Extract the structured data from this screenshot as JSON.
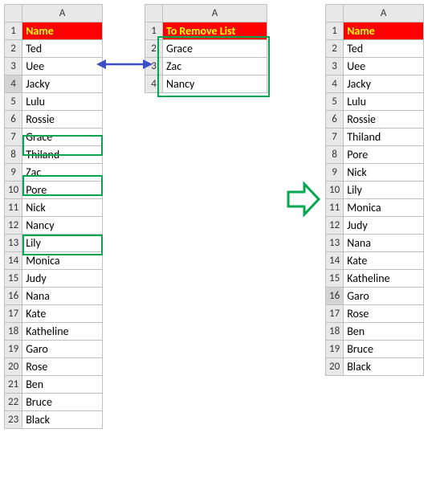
{
  "sheet1": {
    "col": "A",
    "header": "Name",
    "rows": [
      "Ted",
      "Uee",
      "Jacky",
      "Lulu",
      "Rossie",
      "Grace",
      "Thiland",
      "Zac",
      "Pore",
      "Nick",
      "Nancy",
      "Lily",
      "Monica",
      "Judy",
      "Nana",
      "Kate",
      "Katheline",
      "Garo",
      "Rose",
      "Ben",
      "Bruce",
      "Black"
    ]
  },
  "sheet2": {
    "col": "A",
    "header": "To Remove List",
    "rows": [
      "Grace",
      "Zac",
      "Nancy"
    ]
  },
  "sheet3": {
    "col": "A",
    "header": "Name",
    "rows": [
      "Ted",
      "Uee",
      "Jacky",
      "Lulu",
      "Rossie",
      "Thiland",
      "Pore",
      "Nick",
      "Lily",
      "Monica",
      "Judy",
      "Nana",
      "Kate",
      "Katheline",
      "Garo",
      "Rose",
      "Ben",
      "Bruce",
      "Black"
    ]
  }
}
